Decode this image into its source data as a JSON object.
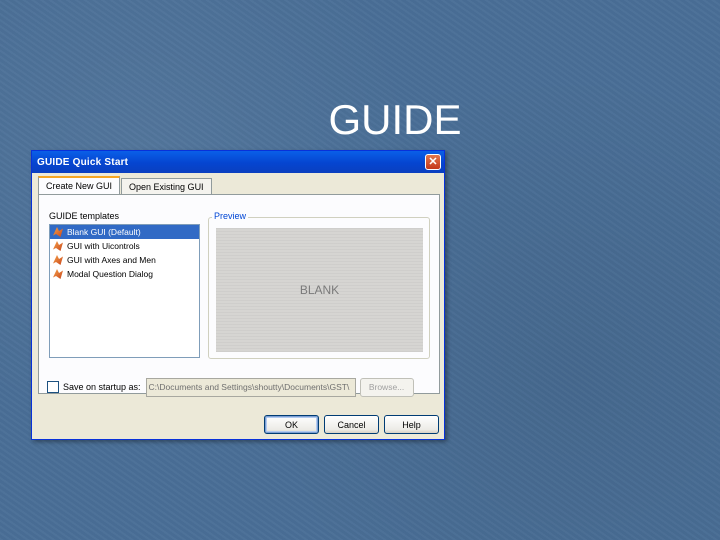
{
  "slide": {
    "title": "GUIDE"
  },
  "dialog": {
    "title": "GUIDE Quick Start",
    "close_glyph": "✕",
    "tabs": [
      {
        "label": "Create New GUI",
        "active": true
      },
      {
        "label": "Open Existing GUI",
        "active": false
      }
    ],
    "templates_label": "GUIDE templates",
    "templates": [
      {
        "label": "Blank GUI (Default)",
        "selected": true,
        "icon": "matlab-icon"
      },
      {
        "label": "GUI with Uicontrols",
        "selected": false,
        "icon": "matlab-icon"
      },
      {
        "label": "GUI with Axes and Men",
        "selected": false,
        "icon": "matlab-icon"
      },
      {
        "label": "Modal Question Dialog",
        "selected": false,
        "icon": "matlab-icon"
      }
    ],
    "preview_label": "Preview",
    "preview_text": "BLANK",
    "save_on_startup": {
      "label": "Save on startup as:",
      "checked": false
    },
    "path_value": "C:\\Documents and Settings\\shoutty\\Documents\\GST\\",
    "browse_label": "Browse...",
    "buttons": {
      "ok": "OK",
      "cancel": "Cancel",
      "help": "Help"
    }
  },
  "colors": {
    "background": "#4a6f97",
    "titlebar": "#0545d0",
    "selection": "#316ac5",
    "preview_label": "#0046d5"
  }
}
